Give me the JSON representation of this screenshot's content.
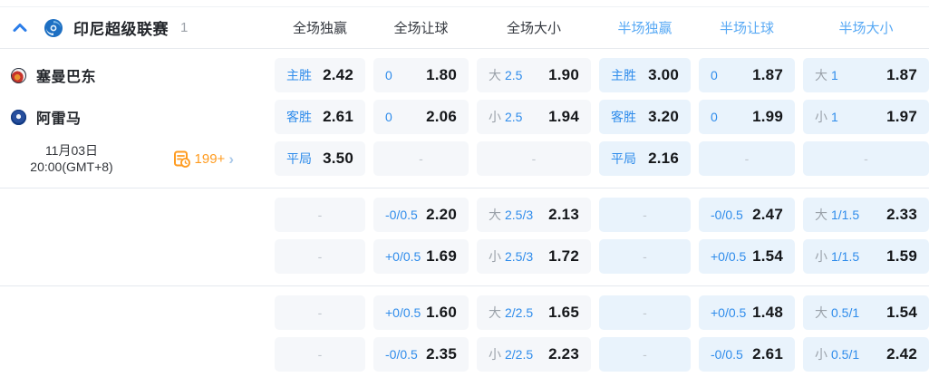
{
  "colors": {
    "accent_blue": "#2f8ceb",
    "half_header_blue": "#58a9f4",
    "full_cell_bg": "#f5f7fa",
    "half_cell_bg": "#e9f3fc",
    "orange": "#ff9b1f",
    "odds_text": "#15171a",
    "gray_label": "#9aa1a9"
  },
  "header": {
    "league": "印尼超级联赛",
    "count": "1",
    "columns": [
      {
        "label": "全场独赢",
        "period": "full"
      },
      {
        "label": "全场让球",
        "period": "full"
      },
      {
        "label": "全场大小",
        "period": "full"
      },
      {
        "label": "半场独赢",
        "period": "half"
      },
      {
        "label": "半场让球",
        "period": "half"
      },
      {
        "label": "半场大小",
        "period": "half"
      }
    ]
  },
  "match": {
    "home": "塞曼巴东",
    "away": "阿雷马",
    "date_line1": "11月03日",
    "date_line2": "20:00(GMT+8)",
    "more_markets": "199+",
    "more_chevron": "›",
    "dash": "-"
  },
  "groups": [
    {
      "rows": [
        {
          "cells": [
            {
              "g": "",
              "b": "主胜",
              "v": "2.42"
            },
            {
              "g": "",
              "b": "0",
              "v": "1.80"
            },
            {
              "g": "大",
              "b": "2.5",
              "v": "1.90"
            },
            {
              "g": "",
              "b": "主胜",
              "v": "3.00"
            },
            {
              "g": "",
              "b": "0",
              "v": "1.87"
            },
            {
              "g": "大",
              "b": "1",
              "v": "1.87"
            }
          ]
        },
        {
          "cells": [
            {
              "g": "",
              "b": "客胜",
              "v": "2.61"
            },
            {
              "g": "",
              "b": "0",
              "v": "2.06"
            },
            {
              "g": "小",
              "b": "2.5",
              "v": "1.94"
            },
            {
              "g": "",
              "b": "客胜",
              "v": "3.20"
            },
            {
              "g": "",
              "b": "0",
              "v": "1.99"
            },
            {
              "g": "小",
              "b": "1",
              "v": "1.97"
            }
          ]
        },
        {
          "cells": [
            {
              "g": "",
              "b": "平局",
              "v": "3.50"
            },
            {
              "dash": true
            },
            {
              "dash": true
            },
            {
              "g": "",
              "b": "平局",
              "v": "2.16"
            },
            {
              "dash": true
            },
            {
              "dash": true
            }
          ]
        }
      ]
    },
    {
      "rows": [
        {
          "cells": [
            {
              "dash": true
            },
            {
              "g": "",
              "b": "-0/0.5",
              "v": "2.20"
            },
            {
              "g": "大",
              "b": "2.5/3",
              "v": "2.13"
            },
            {
              "dash": true
            },
            {
              "g": "",
              "b": "-0/0.5",
              "v": "2.47"
            },
            {
              "g": "大",
              "b": "1/1.5",
              "v": "2.33"
            }
          ]
        },
        {
          "cells": [
            {
              "dash": true
            },
            {
              "g": "",
              "b": "+0/0.5",
              "v": "1.69"
            },
            {
              "g": "小",
              "b": "2.5/3",
              "v": "1.72"
            },
            {
              "dash": true
            },
            {
              "g": "",
              "b": "+0/0.5",
              "v": "1.54"
            },
            {
              "g": "小",
              "b": "1/1.5",
              "v": "1.59"
            }
          ]
        }
      ]
    },
    {
      "rows": [
        {
          "cells": [
            {
              "dash": true
            },
            {
              "g": "",
              "b": "+0/0.5",
              "v": "1.60"
            },
            {
              "g": "大",
              "b": "2/2.5",
              "v": "1.65"
            },
            {
              "dash": true
            },
            {
              "g": "",
              "b": "+0/0.5",
              "v": "1.48"
            },
            {
              "g": "大",
              "b": "0.5/1",
              "v": "1.54"
            }
          ]
        },
        {
          "cells": [
            {
              "dash": true
            },
            {
              "g": "",
              "b": "-0/0.5",
              "v": "2.35"
            },
            {
              "g": "小",
              "b": "2/2.5",
              "v": "2.23"
            },
            {
              "dash": true
            },
            {
              "g": "",
              "b": "-0/0.5",
              "v": "2.61"
            },
            {
              "g": "小",
              "b": "0.5/1",
              "v": "2.42"
            }
          ]
        }
      ]
    }
  ]
}
